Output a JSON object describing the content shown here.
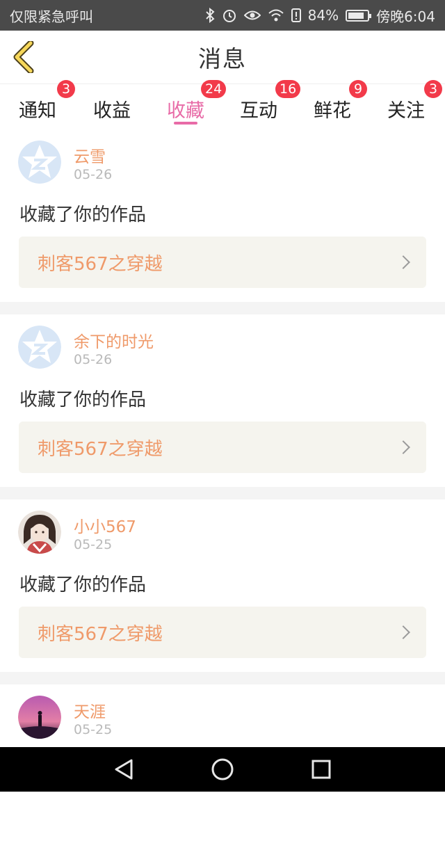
{
  "status_bar": {
    "left_text": "仅限紧急呼叫",
    "battery_percent": "84%",
    "time": "傍晚6:04",
    "battery_level": 0.84
  },
  "header": {
    "title": "消息"
  },
  "tabs": [
    {
      "label": "通知",
      "badge": "3",
      "active": false
    },
    {
      "label": "收益",
      "badge": "",
      "active": false
    },
    {
      "label": "收藏",
      "badge": "24",
      "active": true
    },
    {
      "label": "互动",
      "badge": "16",
      "active": false
    },
    {
      "label": "鲜花",
      "badge": "9",
      "active": false
    },
    {
      "label": "关注",
      "badge": "3",
      "active": false
    }
  ],
  "messages": [
    {
      "name": "云雪",
      "date": "05-26",
      "text": "收藏了你的作品",
      "work": "刺客567之穿越",
      "avatar": "default"
    },
    {
      "name": "余下的时光",
      "date": "05-26",
      "text": "收藏了你的作品",
      "work": "刺客567之穿越",
      "avatar": "default"
    },
    {
      "name": "小小567",
      "date": "05-25",
      "text": "收藏了你的作品",
      "work": "刺客567之穿越",
      "avatar": "photo-girl"
    },
    {
      "name": "天涯",
      "date": "05-25",
      "text": "",
      "work": "",
      "avatar": "photo-sunset"
    }
  ],
  "colors": {
    "accent": "#e86ba7",
    "badge": "#f23a4a",
    "orange_text": "#ef9a6a",
    "status_bar": "#4a4a4a"
  },
  "icons": {
    "back": "chevron-left-icon",
    "bluetooth": "bluetooth-icon",
    "alarm": "alarm-icon",
    "eye": "eye-icon",
    "wifi": "wifi-icon",
    "sim": "sim-icon",
    "battery": "battery-icon",
    "nav_back": "triangle-back-icon",
    "nav_home": "circle-home-icon",
    "nav_recent": "square-recent-icon"
  }
}
